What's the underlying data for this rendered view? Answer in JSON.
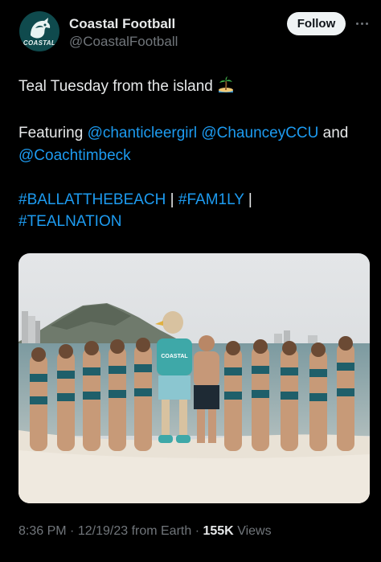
{
  "account": {
    "display_name": "Coastal Football",
    "handle": "@CoastalFootball",
    "avatar_text": "COASTAL",
    "follow_label": "Follow"
  },
  "tweet": {
    "line1": "Teal Tuesday from the island",
    "emoji": "desert-island-emoji",
    "featuring_prefix": "Featuring",
    "mention1": "@chanticleergirl",
    "mention2": "@ChaunceyCCU",
    "and": "and",
    "mention3": "@Coachtimbeck",
    "hashtag1": "#BALLATTHEBEACH",
    "sep1": "|",
    "hashtag2": "#FAM1LY",
    "sep2": "|",
    "hashtag3": "#TEALNATION"
  },
  "photo": {
    "mascot_shirt": "COASTAL"
  },
  "meta": {
    "time": "8:36 PM",
    "dot1": "·",
    "date": "12/19/23",
    "source": "from Earth",
    "dot2": "·",
    "views_count": "155K",
    "views_label": "Views"
  },
  "colors": {
    "link": "#1d9bf0",
    "text": "#e7e9ea",
    "muted": "#71767b",
    "teal": "#0f4a4d"
  }
}
